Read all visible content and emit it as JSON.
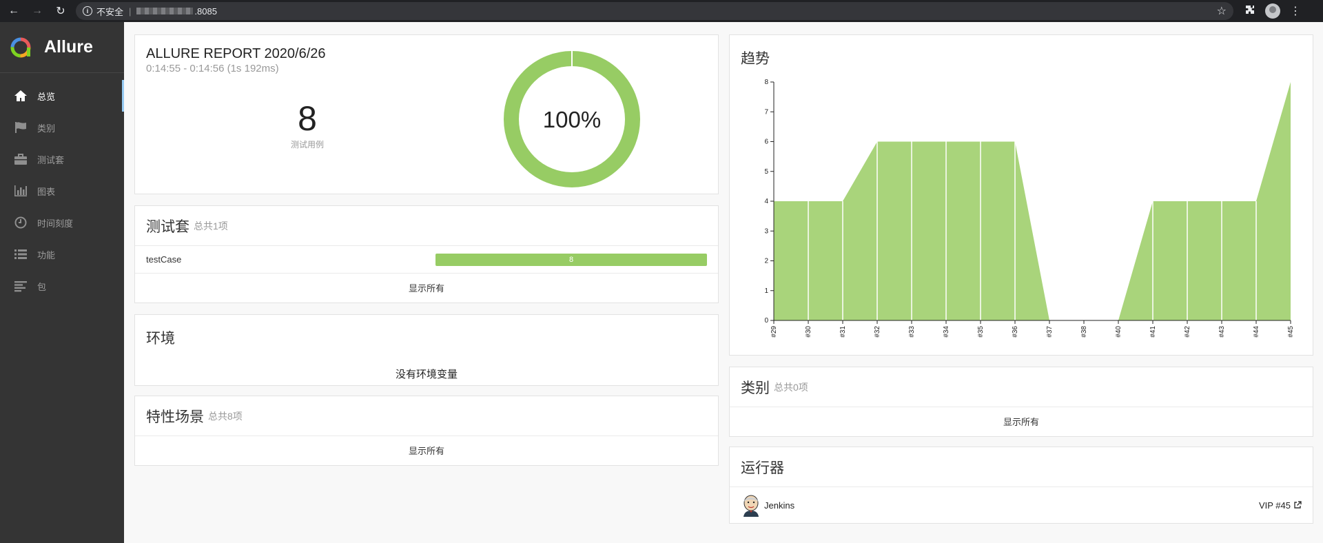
{
  "browser": {
    "security_label": "不安全",
    "url_suffix": ".8085"
  },
  "sidebar": {
    "brand": "Allure",
    "items": [
      {
        "label": "总览",
        "icon": "home-icon",
        "active": true
      },
      {
        "label": "类别",
        "icon": "flag-icon",
        "active": false
      },
      {
        "label": "测试套",
        "icon": "briefcase-icon",
        "active": false
      },
      {
        "label": "图表",
        "icon": "bar-chart-icon",
        "active": false
      },
      {
        "label": "时间刻度",
        "icon": "clock-icon",
        "active": false
      },
      {
        "label": "功能",
        "icon": "list-icon",
        "active": false
      },
      {
        "label": "包",
        "icon": "align-left-icon",
        "active": false
      }
    ]
  },
  "summary": {
    "title": "ALLURE REPORT 2020/6/26",
    "time_range": "0:14:55 - 0:14:56 (1s 192ms)",
    "test_count": "8",
    "test_count_label": "测试用例",
    "pass_rate": "100%"
  },
  "suites": {
    "title": "测试套",
    "subtitle": "总共1项",
    "rows": [
      {
        "name": "testCase",
        "count": "8"
      }
    ],
    "show_all": "显示所有"
  },
  "environment": {
    "title": "环境",
    "empty": "没有环境变量"
  },
  "features": {
    "title": "特性场景",
    "subtitle": "总共8项",
    "show_all": "显示所有"
  },
  "trend": {
    "title": "趋势"
  },
  "categories": {
    "title": "类别",
    "subtitle": "总共0项",
    "show_all": "显示所有"
  },
  "executors": {
    "title": "运行器",
    "name": "Jenkins",
    "build": "VIP #45"
  },
  "colors": {
    "passed": "#97cc64",
    "sidebar": "#343434",
    "accent": "#97cbf3"
  },
  "chart_data": {
    "type": "area",
    "title": "趋势",
    "x": [
      "#29",
      "#30",
      "#31",
      "#32",
      "#33",
      "#34",
      "#35",
      "#36",
      "#37",
      "#38",
      "#40",
      "#41",
      "#42",
      "#43",
      "#44",
      "#45"
    ],
    "series": [
      {
        "values": [
          4,
          4,
          4,
          6,
          6,
          6,
          6,
          6,
          0,
          0,
          0,
          4,
          4,
          4,
          4,
          8
        ]
      }
    ],
    "ylim": [
      0,
      8
    ],
    "yticks": [
      0,
      1,
      2,
      3,
      4,
      5,
      6,
      7,
      8
    ],
    "grid": false
  }
}
